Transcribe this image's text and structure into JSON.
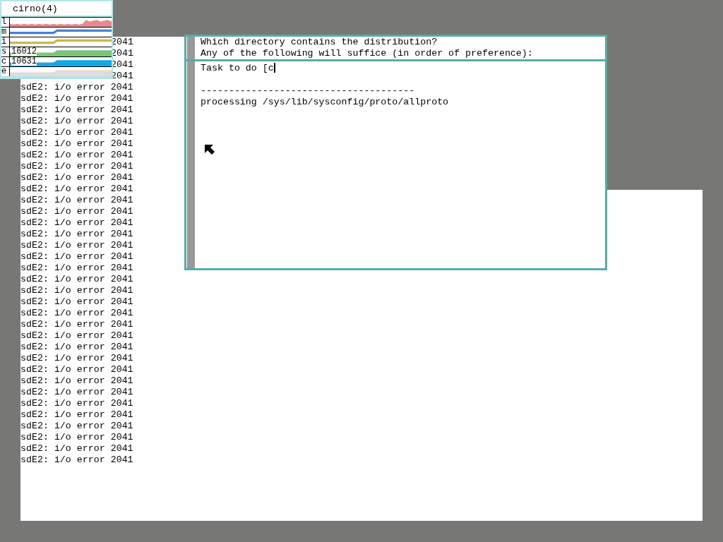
{
  "stats": {
    "title": "cirno(4)",
    "rows": [
      {
        "label": "l",
        "color": "#e88a8a",
        "kind": "area"
      },
      {
        "label": "m",
        "color": "#4a7fd0",
        "kind": "line"
      },
      {
        "label": "i",
        "color": "#c8b84a",
        "kind": "line"
      },
      {
        "label": "s",
        "color": "#7cc47a",
        "kind": "area",
        "reading": "16012"
      },
      {
        "label": "c",
        "color": "#1aa4e8",
        "kind": "area",
        "reading": "10631"
      },
      {
        "label": "e",
        "color": "#dddddd",
        "kind": "area"
      }
    ]
  },
  "console": {
    "lines": [
      {
        "text": "2041",
        "kind": "tail"
      },
      {
        "text": "2041",
        "kind": "tail"
      },
      {
        "text": "2041",
        "kind": "tail"
      },
      {
        "text": "2041",
        "kind": "tail"
      },
      {
        "text": "sdE2: i/o error 2041",
        "kind": "full"
      },
      {
        "text": "sdE2: i/o error 2041",
        "kind": "full"
      },
      {
        "text": "sdE2: i/o error 2041",
        "kind": "full"
      },
      {
        "text": "sdE2: i/o error 2041",
        "kind": "full"
      },
      {
        "text": "sdE2: i/o error 2041",
        "kind": "full"
      },
      {
        "text": "sdE2: i/o error 2041",
        "kind": "full"
      },
      {
        "text": "sdE2: i/o error 2041",
        "kind": "full"
      },
      {
        "text": "sdE2: i/o error 2041",
        "kind": "full"
      },
      {
        "text": "sdE2: i/o error 2041",
        "kind": "full"
      },
      {
        "text": "sdE2: i/o error 2041",
        "kind": "full"
      },
      {
        "text": "sdE2: i/o error 2041",
        "kind": "full"
      },
      {
        "text": "sdE2: i/o error 2041",
        "kind": "full"
      },
      {
        "text": "sdE2: i/o error 2041",
        "kind": "full"
      },
      {
        "text": "sdE2: i/o error 2041",
        "kind": "full"
      },
      {
        "text": "sdE2: i/o error 2041",
        "kind": "full"
      },
      {
        "text": "sdE2: i/o error 2041",
        "kind": "full"
      },
      {
        "text": "sdE2: i/o error 2041",
        "kind": "full"
      },
      {
        "text": "sdE2: i/o error 2041",
        "kind": "full"
      },
      {
        "text": "sdE2: i/o error 2041",
        "kind": "full"
      },
      {
        "text": "sdE2: i/o error 2041",
        "kind": "full"
      },
      {
        "text": "sdE2: i/o error 2041",
        "kind": "full"
      },
      {
        "text": "sdE2: i/o error 2041",
        "kind": "full"
      },
      {
        "text": "sdE2: i/o error 2041",
        "kind": "full"
      },
      {
        "text": "sdE2: i/o error 2041",
        "kind": "full"
      },
      {
        "text": "sdE2: i/o error 2041",
        "kind": "full"
      },
      {
        "text": "sdE2: i/o error 2041",
        "kind": "full"
      },
      {
        "text": "sdE2: i/o error 2041",
        "kind": "full"
      },
      {
        "text": "sdE2: i/o error 2041",
        "kind": "full"
      },
      {
        "text": "sdE2: i/o error 2041",
        "kind": "full"
      },
      {
        "text": "sdE2: i/o error 2041",
        "kind": "full"
      },
      {
        "text": "sdE2: i/o error 2041",
        "kind": "full"
      },
      {
        "text": "sdE2: i/o error 2041",
        "kind": "full"
      },
      {
        "text": "sdE2: i/o error 2041",
        "kind": "full"
      },
      {
        "text": "sdE2: i/o error 2041",
        "kind": "full"
      }
    ]
  },
  "terminal": {
    "upper_lines": [
      "Which directory contains the distribution?",
      "Any of the following will suffice (in order of preference):"
    ],
    "lower_lines": [
      "Task to do [c",
      "--------------------------------------",
      "processing /sys/lib/sysconfig/proto/allproto"
    ]
  }
}
